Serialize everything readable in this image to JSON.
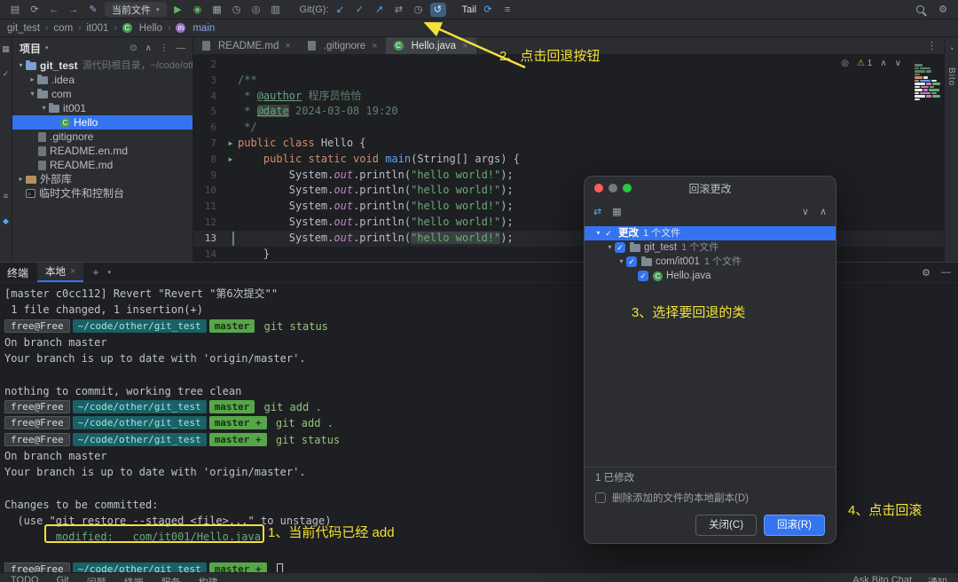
{
  "icons": {
    "save": "▤",
    "sync": "⟳",
    "back": "←",
    "forward": "→",
    "edit": "✎",
    "chevron_down": "▾",
    "run": "▶",
    "debug": "◉",
    "coverage": "▦",
    "profiler": "◷",
    "browser": "◎",
    "services": "▥",
    "git_update": "↙",
    "git_commit": "✓",
    "git_push": "↗",
    "git_diff": "⇄",
    "history": "◷",
    "rollback": "↺",
    "tail_run": "⟳",
    "menu": "≡",
    "settings": "⚙",
    "more": "⋮",
    "plus": "+",
    "minimize": "—",
    "locate": "⊙",
    "collapse_all": "∧",
    "expand_all": "∨",
    "group_by": "▦",
    "warning": "⚠",
    "eye": "◎",
    "bell": "◔",
    "close": "×",
    "project_tool": "▦",
    "structure_tool": "≡",
    "bookmark_tool": "◆"
  },
  "toolbar": {
    "run_config_label": "当前文件",
    "git_label": "Git(G):",
    "tail_label": "Tail"
  },
  "breadcrumb": [
    {
      "label": "git_test"
    },
    {
      "label": "com"
    },
    {
      "label": "it001"
    },
    {
      "label": "Hello",
      "icon": "class"
    },
    {
      "label": "main",
      "icon": "method",
      "color": "#8ba1e8"
    }
  ],
  "project": {
    "title": "项目",
    "items": [
      {
        "chev": "▾",
        "icon": "module",
        "label": "git_test",
        "suffix": "源代码根目录，~/code/other...",
        "depth": 0,
        "bold": true
      },
      {
        "chev": "▸",
        "icon": "folder",
        "label": ".idea",
        "depth": 1
      },
      {
        "chev": "▾",
        "icon": "folder",
        "label": "com",
        "depth": 1
      },
      {
        "chev": "▾",
        "icon": "folder",
        "label": "it001",
        "depth": 2
      },
      {
        "icon": "class",
        "label": "Hello",
        "depth": 3,
        "selected": true
      },
      {
        "icon": "file",
        "label": ".gitignore",
        "depth": 1
      },
      {
        "icon": "file",
        "label": "README.en.md",
        "depth": 1
      },
      {
        "icon": "file",
        "label": "README.md",
        "depth": 1
      },
      {
        "chev": "▸",
        "icon": "lib",
        "label": "外部库",
        "depth": 0
      },
      {
        "icon": "console",
        "label": "临时文件和控制台",
        "depth": 0
      }
    ]
  },
  "tabs": [
    {
      "icon": "file",
      "label": "README.md"
    },
    {
      "icon": "file",
      "label": ".gitignore"
    },
    {
      "icon": "class",
      "label": "Hello.java",
      "active": true
    }
  ],
  "editor": {
    "warning_count": "1",
    "lines": [
      {
        "no": "2",
        "segs": []
      },
      {
        "no": "3",
        "segs": [
          [
            "cmt",
            "/**"
          ]
        ]
      },
      {
        "no": "4",
        "segs": [
          [
            "cmt",
            " * "
          ],
          [
            "tag",
            "@author"
          ],
          [
            "cmt",
            " 程序员恰恰"
          ]
        ]
      },
      {
        "no": "5",
        "segs": [
          [
            "cmt",
            " * "
          ],
          [
            "tagh",
            "@date"
          ],
          [
            "cmt",
            " 2024-03-08 19:20"
          ]
        ]
      },
      {
        "no": "6",
        "segs": [
          [
            "cmt",
            " */"
          ]
        ]
      },
      {
        "no": "7",
        "run": true,
        "segs": [
          [
            "kw",
            "public class "
          ],
          [
            "pln",
            "Hello {"
          ]
        ]
      },
      {
        "no": "8",
        "run": true,
        "segs": [
          [
            "pln",
            "    "
          ],
          [
            "kw",
            "public static void "
          ],
          [
            "mth",
            "main"
          ],
          [
            "pln",
            "(String[] args) {"
          ]
        ]
      },
      {
        "no": "9",
        "segs": [
          [
            "pln",
            "        System."
          ],
          [
            "fld",
            "out"
          ],
          [
            "pln",
            ".println("
          ],
          [
            "str",
            "\"hello world!\""
          ],
          [
            "pln",
            ");"
          ]
        ]
      },
      {
        "no": "10",
        "segs": [
          [
            "pln",
            "        System."
          ],
          [
            "fld",
            "out"
          ],
          [
            "pln",
            ".println("
          ],
          [
            "str",
            "\"hello world!\""
          ],
          [
            "pln",
            ");"
          ]
        ]
      },
      {
        "no": "11",
        "segs": [
          [
            "pln",
            "        System."
          ],
          [
            "fld",
            "out"
          ],
          [
            "pln",
            ".println("
          ],
          [
            "str",
            "\"hello world!\""
          ],
          [
            "pln",
            ");"
          ]
        ]
      },
      {
        "no": "12",
        "segs": [
          [
            "pln",
            "        System."
          ],
          [
            "fld",
            "out"
          ],
          [
            "pln",
            ".println("
          ],
          [
            "str",
            "\"hello world!\""
          ],
          [
            "pln",
            ");"
          ]
        ]
      },
      {
        "no": "13",
        "current": true,
        "added": true,
        "segs": [
          [
            "pln",
            "        System."
          ],
          [
            "fld",
            "out"
          ],
          [
            "pln",
            ".println("
          ],
          [
            "strh",
            "\"hello world!\""
          ],
          [
            "pln",
            ");"
          ]
        ]
      },
      {
        "no": "14",
        "segs": [
          [
            "pln",
            "    }"
          ]
        ]
      }
    ],
    "minimap": [
      [
        "#5f826b"
      ],
      [
        "#5f826b",
        "#5f826b"
      ],
      [
        "#5f826b",
        "#5f826b"
      ],
      [
        "#5f826b"
      ],
      [
        "#cf8e6d",
        "#e8e9eb"
      ],
      [
        "#cf8e6d",
        "#56a8f5",
        "#e8e9eb"
      ],
      [
        "#e8e9eb",
        "#c77dbb",
        "#6aab73"
      ],
      [
        "#e8e9eb",
        "#c77dbb",
        "#6aab73"
      ],
      [
        "#e8e9eb",
        "#c77dbb",
        "#6aab73"
      ],
      [
        "#e8e9eb",
        "#c77dbb",
        "#6aab73"
      ],
      [
        "#e8e9eb",
        "#c77dbb",
        "#6aab73"
      ],
      [
        "#e8e9eb"
      ]
    ]
  },
  "rightstrip": {
    "bito_label": "Bito"
  },
  "terminal": {
    "title": "终端",
    "tab_label": "本地",
    "lines": [
      {
        "type": "plain",
        "text": "[master c0cc112] Revert \"Revert \"第6次提交\"\""
      },
      {
        "type": "plain",
        "text": " 1 file changed, 1 insertion(+)"
      },
      {
        "type": "prompt",
        "user": "free@Free",
        "path": "~/code/other/git_test",
        "branch": "master",
        "cmd": "git status"
      },
      {
        "type": "plain",
        "text": "On branch master"
      },
      {
        "type": "plain",
        "text": "Your branch is up to date with 'origin/master'."
      },
      {
        "type": "blank"
      },
      {
        "type": "plain",
        "text": "nothing to commit, working tree clean"
      },
      {
        "type": "prompt",
        "user": "free@Free",
        "path": "~/code/other/git_test",
        "branch": "master",
        "cmd": "git add ."
      },
      {
        "type": "prompt",
        "user": "free@Free",
        "path": "~/code/other/git_test",
        "branch": "master +",
        "cmd": "git add ."
      },
      {
        "type": "prompt",
        "user": "free@Free",
        "path": "~/code/other/git_test",
        "branch": "master +",
        "cmd": "git status"
      },
      {
        "type": "plain",
        "text": "On branch master"
      },
      {
        "type": "plain",
        "text": "Your branch is up to date with 'origin/master'."
      },
      {
        "type": "blank"
      },
      {
        "type": "plain",
        "text": "Changes to be committed:"
      },
      {
        "type": "plain",
        "text": "  (use \"git restore --staged <file>...\" to unstage)"
      },
      {
        "type": "modified",
        "text": "        modified:   com/it001/Hello.java"
      },
      {
        "type": "blank"
      },
      {
        "type": "prompt",
        "user": "free@Free",
        "path": "~/code/other/git_test",
        "branch": "master +",
        "cursor": true
      }
    ]
  },
  "dialog": {
    "title": "回滚更改",
    "tree": [
      {
        "depth": 0,
        "chev": "▾",
        "label": "更改",
        "count": "1 个文件",
        "selected": true,
        "bold": true
      },
      {
        "depth": 1,
        "chev": "▾",
        "icon": "folder",
        "label": "git_test",
        "count": "1 个文件"
      },
      {
        "depth": 2,
        "chev": "▾",
        "icon": "folder",
        "label": "com/it001",
        "count": "1 个文件"
      },
      {
        "depth": 3,
        "icon": "class",
        "label": "Hello.java"
      }
    ],
    "summary": "1 已修改",
    "checkbox_label": "删除添加的文件的本地副本(D)",
    "close_label": "关闭(C)",
    "rollback_label": "回滚(R)"
  },
  "statusbar": {
    "left": [
      "TODO",
      "Git",
      "问题",
      "终端",
      "服务",
      "构建"
    ],
    "right": [
      "Ask Bito Chat",
      "通知"
    ]
  },
  "annotations": {
    "step1": "1、当前代码已经 add",
    "step2": "2、点击回退按钮",
    "step3": "3、选择要回退的类",
    "step4": "4、点击回滚"
  }
}
